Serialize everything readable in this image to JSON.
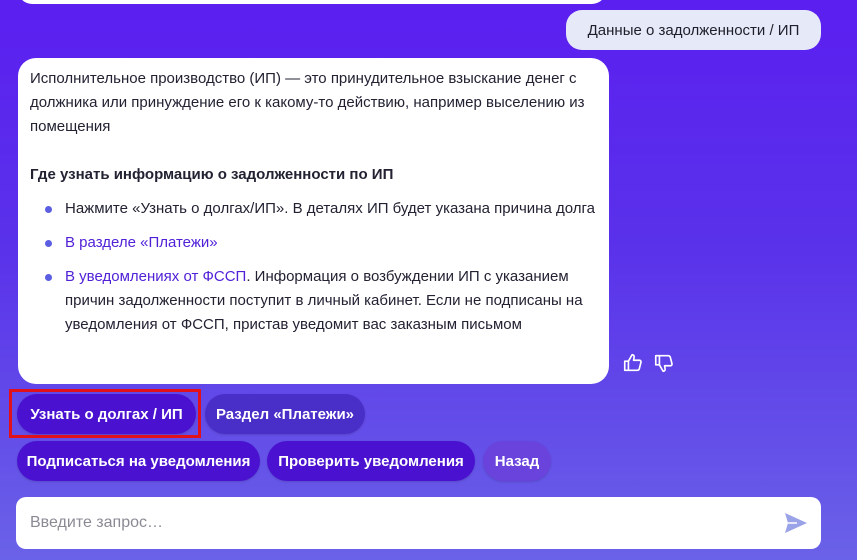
{
  "user_message": "Данные о задолженности / ИП",
  "bot_message": {
    "intro": "Исполнительное производство (ИП) — это принудительное взыскание денег с должника или принуждение его к какому-то действию, например выселению из помещения",
    "heading": "Где узнать информацию о задолженности по ИП",
    "items": [
      {
        "link": "",
        "text": "Нажмите «Узнать о долгах/ИП». В деталях ИП будет указана причина долга"
      },
      {
        "link": "В разделе «Платежи»",
        "text": ""
      },
      {
        "link": "В уведомлениях от ФССП",
        "text": ". Информация о возбуждении ИП с указанием причин задолженности поступит в личный кабинет. Если не подписаны на уведомления от ФССП, пристав уведомит вас заказным письмом"
      }
    ]
  },
  "reactions": {
    "like_icon": "thumbs-up-icon",
    "dislike_icon": "thumbs-down-icon"
  },
  "quick_replies": [
    "Узнать о долгах / ИП",
    "Раздел «Платежи»",
    "Подписаться на уведомления",
    "Проверить уведомления",
    "Назад"
  ],
  "input": {
    "placeholder": "Введите запрос…",
    "value": ""
  },
  "colors": {
    "accent": "#4a12d0",
    "link": "#5121d8",
    "highlight": "#e0111b"
  }
}
